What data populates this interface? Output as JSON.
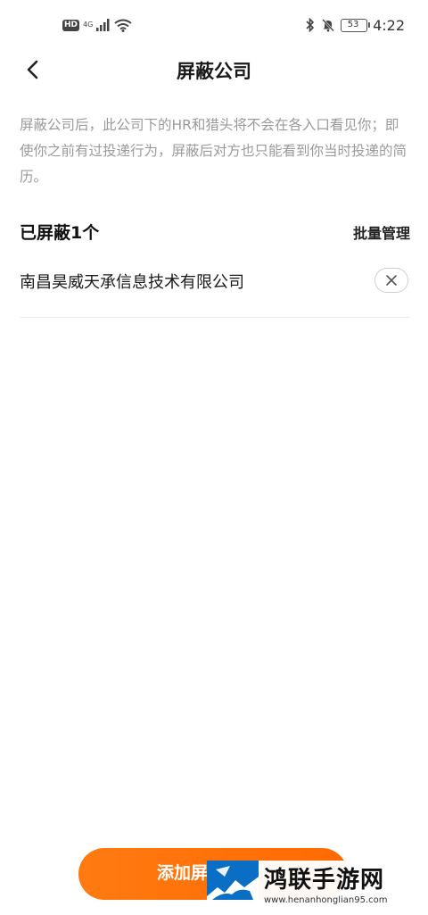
{
  "status_bar": {
    "hd": "HD",
    "network": "4G",
    "battery": "53",
    "time": "4:22"
  },
  "header": {
    "title": "屏蔽公司"
  },
  "intro": {
    "text": "屏蔽公司后，此公司下的HR和猎头将不会在各入口看见你；即使你之前有过投递行为，屏蔽后对方也只能看到你当时投递的简历。"
  },
  "blocked": {
    "title": "已屏蔽1个",
    "bulk_manage": "批量管理",
    "companies": [
      {
        "name": "南昌昊威天承信息技术有限公司"
      }
    ]
  },
  "footer": {
    "add_label": "添加屏"
  },
  "watermark": {
    "title": "鸿联手游网",
    "url": "www.henanhonglian95.com"
  },
  "colors": {
    "accent": "#ff6a00",
    "muted_text": "#9a9a9a",
    "divider": "#eeeeee"
  },
  "icons": {
    "back": "chevron-left-icon",
    "remove": "close-icon",
    "wifi": "wifi-icon",
    "signal": "signal-icon",
    "bluetooth": "bluetooth-icon",
    "mute": "bell-off-icon"
  }
}
